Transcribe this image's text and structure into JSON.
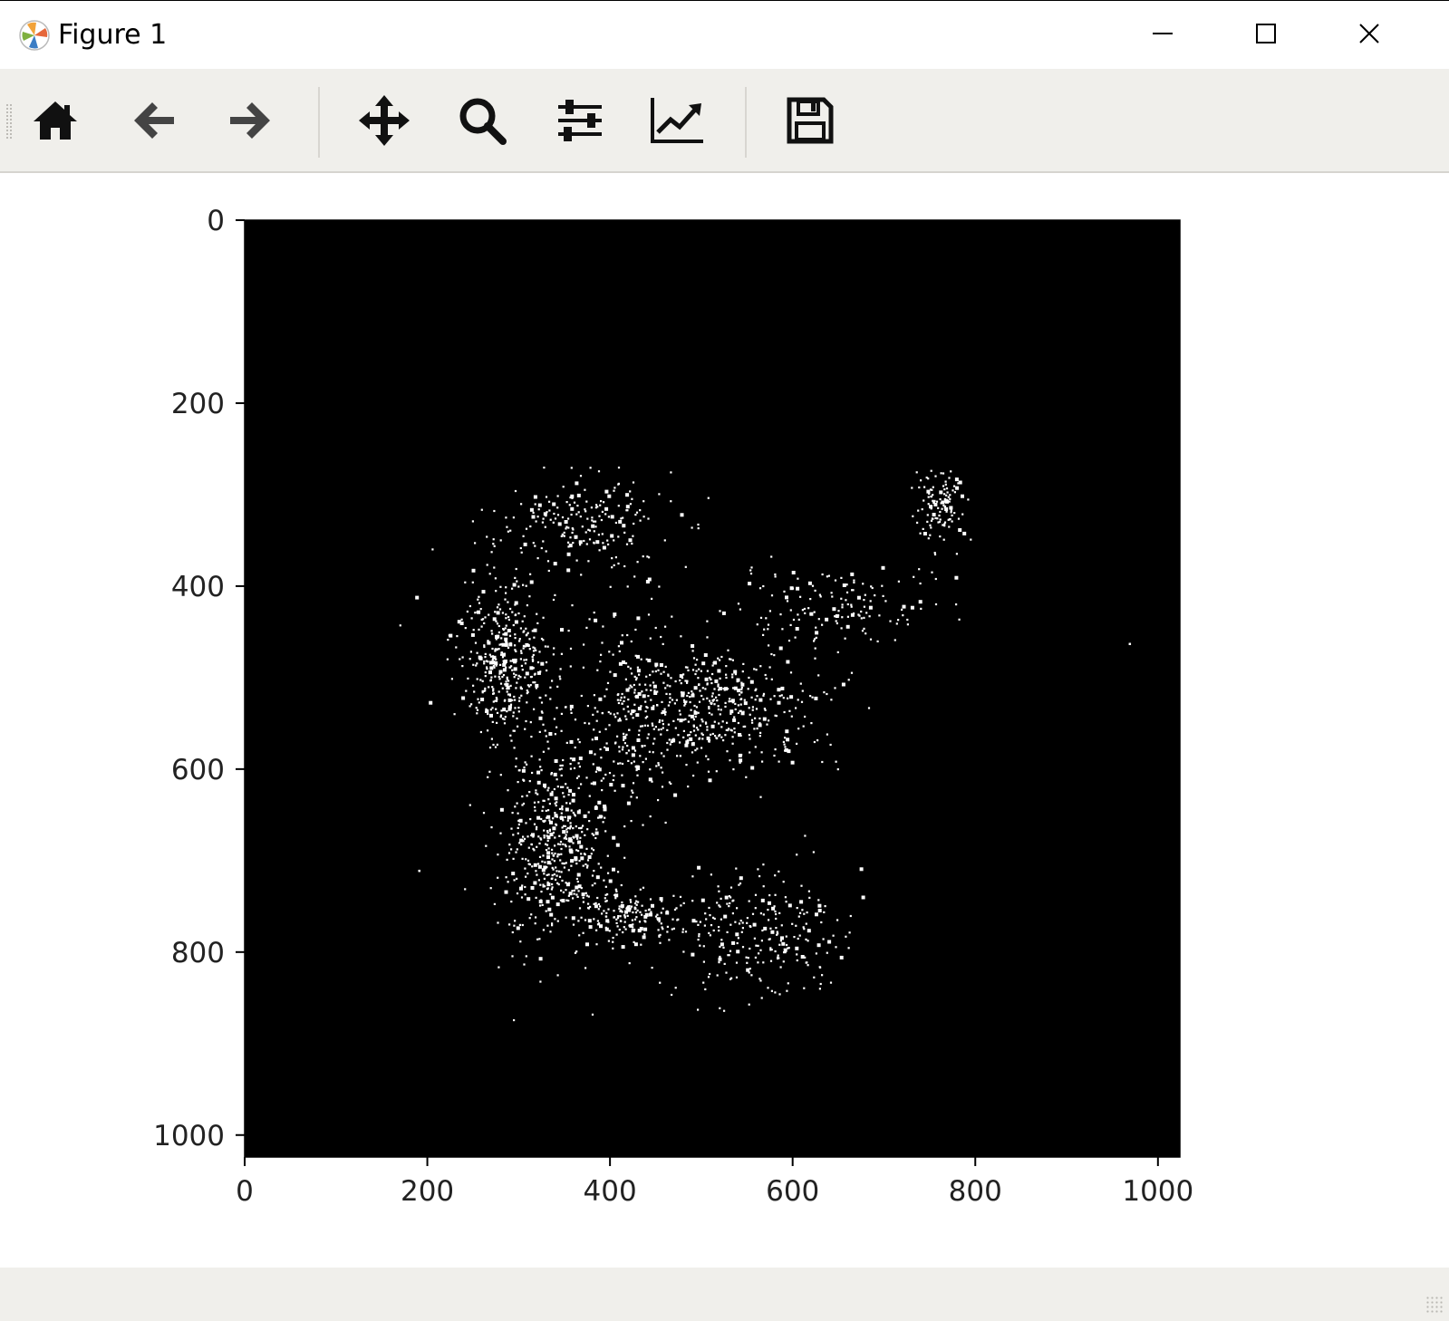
{
  "window": {
    "title": "Figure 1",
    "app_icon": "matplotlib-logo-icon",
    "controls": {
      "minimize_icon": "minimize-icon",
      "maximize_icon": "maximize-icon",
      "close_icon": "close-icon"
    }
  },
  "toolbar": {
    "buttons": [
      {
        "name": "home-button",
        "icon": "home-icon"
      },
      {
        "name": "back-button",
        "icon": "arrow-left-icon"
      },
      {
        "name": "forward-button",
        "icon": "arrow-right-icon"
      },
      {
        "name": "pan-button",
        "icon": "move-arrows-icon"
      },
      {
        "name": "zoom-button",
        "icon": "magnifier-icon"
      },
      {
        "name": "configure-subplots-button",
        "icon": "sliders-icon"
      },
      {
        "name": "edit-axis-button",
        "icon": "line-chart-icon"
      },
      {
        "name": "save-button",
        "icon": "floppy-disk-icon"
      }
    ]
  },
  "chart_data": {
    "type": "scatter",
    "description_kind": "binary image (imshow) of white speckle points on black background",
    "image_size": [
      1024,
      1024
    ],
    "background_color": "#000000",
    "point_color": "#ffffff",
    "x_ticks": [
      "0",
      "200",
      "400",
      "600",
      "800",
      "1000"
    ],
    "y_ticks": [
      "0",
      "200",
      "400",
      "600",
      "800",
      "1000"
    ],
    "xlim": [
      0,
      1024
    ],
    "ylim": [
      1024,
      0
    ],
    "y_inverted": true,
    "title": "",
    "xlabel": "",
    "ylabel": "",
    "clusters": [
      {
        "cx": 370,
        "cy": 330,
        "rx": 95,
        "ry": 50,
        "n": 200
      },
      {
        "cx": 280,
        "cy": 480,
        "rx": 55,
        "ry": 90,
        "n": 420
      },
      {
        "cx": 340,
        "cy": 680,
        "rx": 60,
        "ry": 110,
        "n": 520
      },
      {
        "cx": 510,
        "cy": 530,
        "rx": 110,
        "ry": 70,
        "n": 480
      },
      {
        "cx": 420,
        "cy": 540,
        "rx": 70,
        "ry": 140,
        "n": 220
      },
      {
        "cx": 560,
        "cy": 780,
        "rx": 95,
        "ry": 70,
        "n": 260
      },
      {
        "cx": 650,
        "cy": 420,
        "rx": 110,
        "ry": 45,
        "n": 150
      },
      {
        "cx": 760,
        "cy": 310,
        "rx": 30,
        "ry": 40,
        "n": 120
      },
      {
        "cx": 420,
        "cy": 760,
        "rx": 50,
        "ry": 25,
        "n": 160
      }
    ],
    "isolated_points": [
      [
        968,
        462
      ],
      [
        190,
        710
      ]
    ]
  }
}
